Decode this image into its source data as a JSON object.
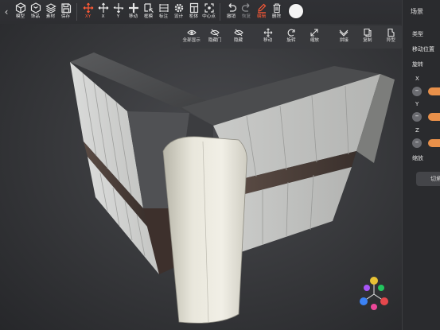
{
  "toolbar": {
    "back_icon": "chevron-left-icon",
    "items": [
      {
        "label": "模型",
        "icon": "cube-icon"
      },
      {
        "label": "饰品",
        "icon": "ornament-icon"
      },
      {
        "label": "素材",
        "icon": "layers-icon"
      },
      {
        "label": "保存",
        "icon": "save-icon"
      },
      {
        "label": "XY",
        "icon": "move-xy-icon",
        "active": true
      },
      {
        "label": "X",
        "icon": "move-x-icon"
      },
      {
        "label": "Y",
        "icon": "move-y-icon"
      },
      {
        "label": "移动",
        "icon": "move-icon"
      },
      {
        "label": "框模",
        "icon": "frame-select-icon"
      },
      {
        "label": "标注",
        "icon": "dimension-icon"
      },
      {
        "label": "设计",
        "icon": "design-gear-icon"
      },
      {
        "label": "柜体",
        "icon": "cabinet-icon"
      },
      {
        "label": "中心点",
        "icon": "center-point-icon"
      },
      {
        "label": "撤销",
        "icon": "undo-icon"
      },
      {
        "label": "恢复",
        "icon": "redo-icon"
      },
      {
        "label": "编辑",
        "icon": "edit-icon",
        "active": true
      },
      {
        "label": "删除",
        "icon": "trash-icon"
      }
    ]
  },
  "subbar": {
    "items": [
      {
        "label": "全部显示",
        "icon": "eye-icon"
      },
      {
        "label": "隐藏门",
        "icon": "eye-off-icon"
      },
      {
        "label": "隐藏",
        "icon": "hide-icon"
      },
      {
        "label": "移动",
        "icon": "move-arrows-icon"
      },
      {
        "label": "旋转",
        "icon": "rotate-icon"
      },
      {
        "label": "缩放",
        "icon": "scale-icon"
      },
      {
        "label": "拼接",
        "icon": "join-icon"
      },
      {
        "label": "复制",
        "icon": "copy-icon"
      },
      {
        "label": "异型",
        "icon": "custom-shape-icon"
      }
    ]
  },
  "panel": {
    "tab": "场景",
    "type_label": "类型",
    "move_position_label": "移动位置",
    "rotate_label": "旋转",
    "axis_x": "X",
    "axis_y": "Y",
    "axis_z": "Z",
    "scale_label": "缩放",
    "cut_button": "切角"
  },
  "colors": {
    "accent": "#ff5a36",
    "slider": "#e8904a",
    "background": "#2b2c2f"
  }
}
